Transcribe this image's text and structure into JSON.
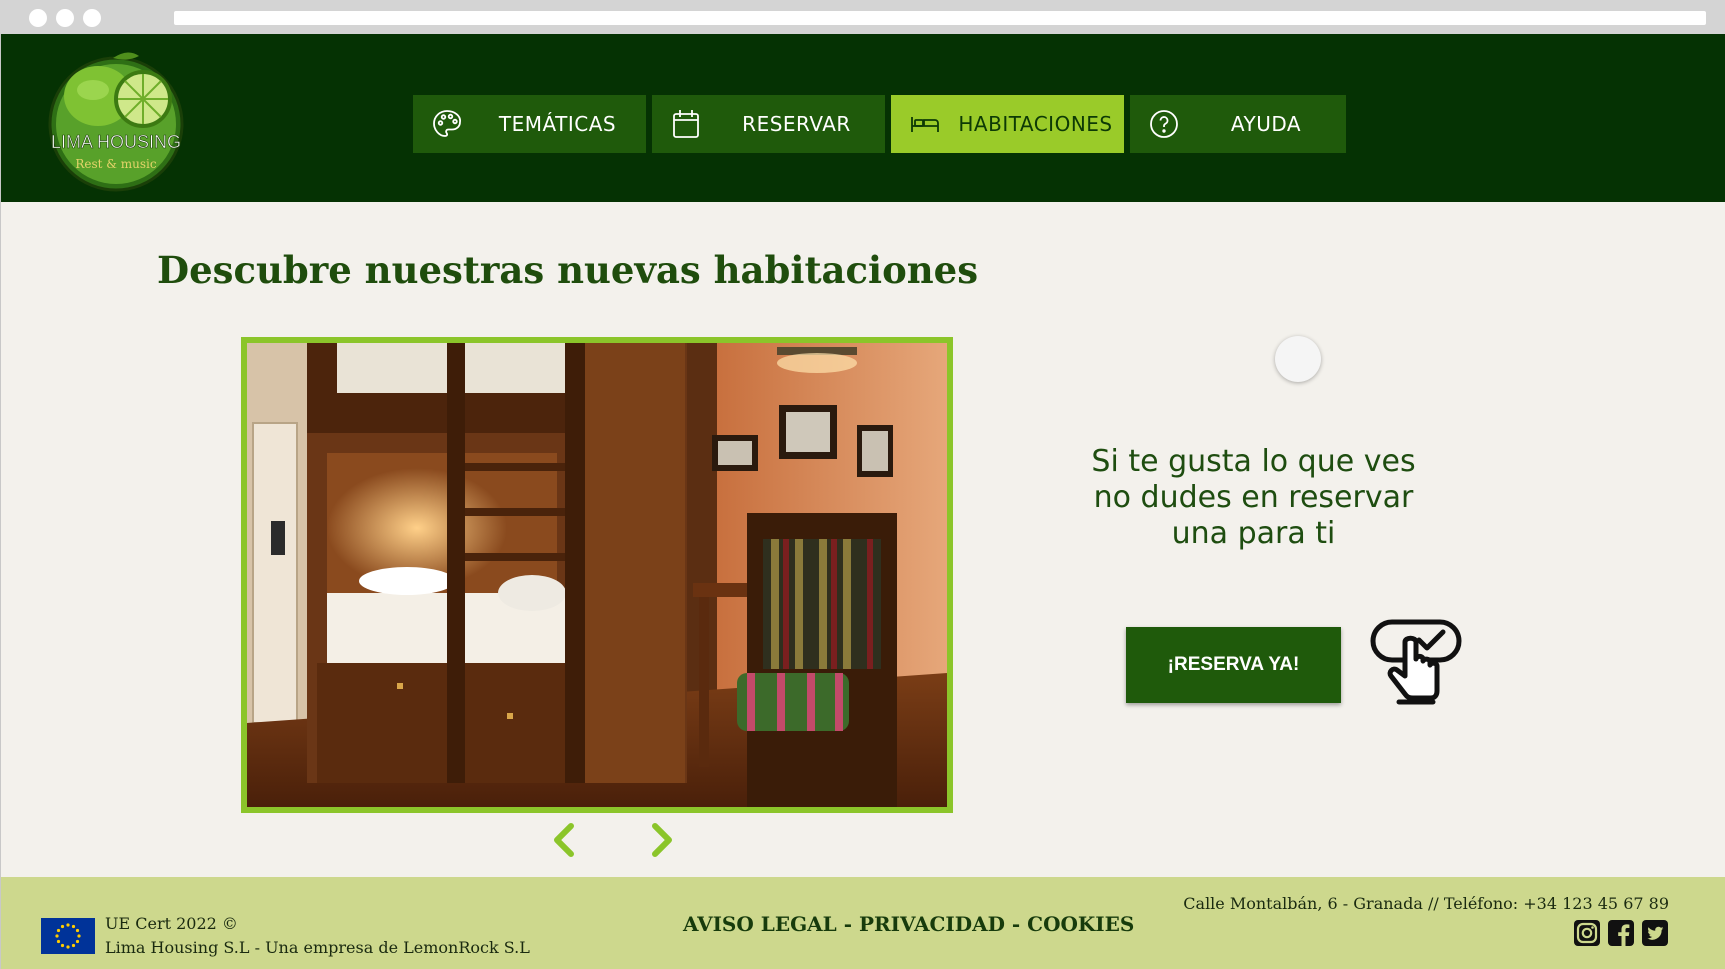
{
  "brand": {
    "name": "LIMA HOUSING",
    "tagline": "Rest & music"
  },
  "nav": {
    "items": [
      {
        "label": "TEMÁTICAS",
        "icon": "palette-icon",
        "active": false
      },
      {
        "label": "RESERVAR",
        "icon": "calendar-icon",
        "active": false
      },
      {
        "label": "HABITACIONES",
        "icon": "bed-icon",
        "active": true
      },
      {
        "label": "AYUDA",
        "icon": "help-circle-icon",
        "active": false
      }
    ]
  },
  "main": {
    "title": "Descubre nuestras nuevas habitaciones",
    "carousel": {
      "prev_icon": "chevron-left-icon",
      "next_icon": "chevron-right-icon"
    },
    "promo_lines": [
      "Si te gusta lo que ves",
      "no dudes en reservar",
      "una para ti"
    ],
    "cta_label": "¡RESERVA YA!",
    "cta_icon": "touch-check-icon"
  },
  "footer": {
    "cert_line1": "UE Cert 2022 ©",
    "cert_line2": "Lima Housing S.L - Una empresa de LemonRock S.L",
    "legal_links": "AVISO LEGAL - PRIVACIDAD - COOKIES",
    "address": "Calle Montalbán, 6 - Granada  // Teléfono: +34 123 45 67 89",
    "social_icons": [
      "instagram-icon",
      "facebook-icon",
      "twitter-icon"
    ]
  },
  "colors": {
    "header_bg": "#053203",
    "nav_bg": "#1f5a0b",
    "nav_active": "#9acb29",
    "footer_bg": "#cdd88d",
    "accent": "#8bc52a"
  }
}
